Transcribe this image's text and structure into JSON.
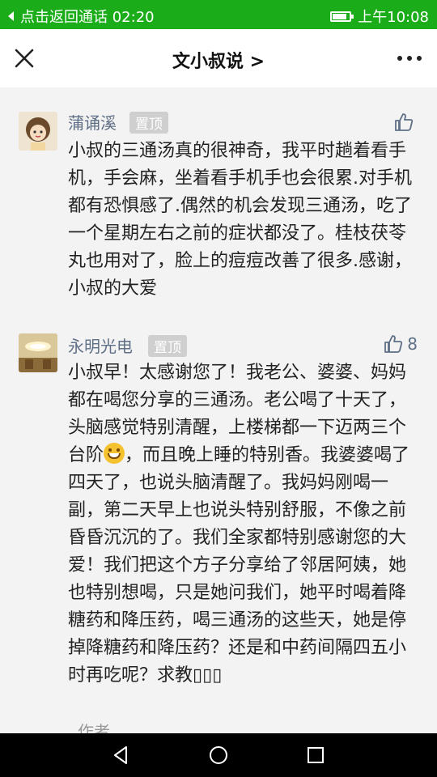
{
  "status_bar": {
    "call_text": "点击返回通话 02:20",
    "time_text": "上午10:08",
    "battery_level": 0.85
  },
  "title_bar": {
    "title": "文小叔说 >",
    "close_icon": "close-icon",
    "more_icon": "more-icon"
  },
  "comments": [
    {
      "name": "蒲诵溪",
      "badge": "置顶",
      "likes": "",
      "text": "小叔的三通汤真的很神奇，我平时趟着看手机，手会麻，坐着看手机手也会很累.对手机都有恐惧感了.偶然的机会发现三通汤，吃了一个星期左右之前的症状都没了。桂枝茯苓丸也用对了，脸上的痘痘改善了很多.感谢，小叔的大爱"
    },
    {
      "name": "永明光电",
      "badge": "置顶",
      "likes": "8",
      "text_before_emoji": "小叔早！太感谢您了！我老公、婆婆、妈妈都在喝您分享的三通汤。老公喝了十天了，头脑感觉特别清醒，上楼梯都一下迈两三个台阶",
      "emoji": "grinning-face-emoji",
      "text_after_emoji": "，而且晚上睡的特别香。我婆婆喝了四天了，也说头脑清醒了。我妈妈刚喝一副，第二天早上也说头特别舒服，不像之前昏昏沉沉的了。我们全家都特别感谢您的大爱！我们把这个方子分享给了邻居阿姨，她也特别想喝，只是她问我们，她平时喝着降糖药和降压药，喝三通汤的这些天，她是停掉降糖药和降压药？还是和中药间隔四五小时再吃呢？求教▯▯▯"
    }
  ],
  "partial_reply": {
    "label": "作者"
  },
  "nav_bar": {
    "back_icon": "back-triangle-icon",
    "home_icon": "home-circle-icon",
    "recents_icon": "recents-square-icon"
  },
  "colors": {
    "status_green": "#1aad19",
    "name_color": "#5f6f86",
    "badge_bg": "#cfcfcf"
  }
}
